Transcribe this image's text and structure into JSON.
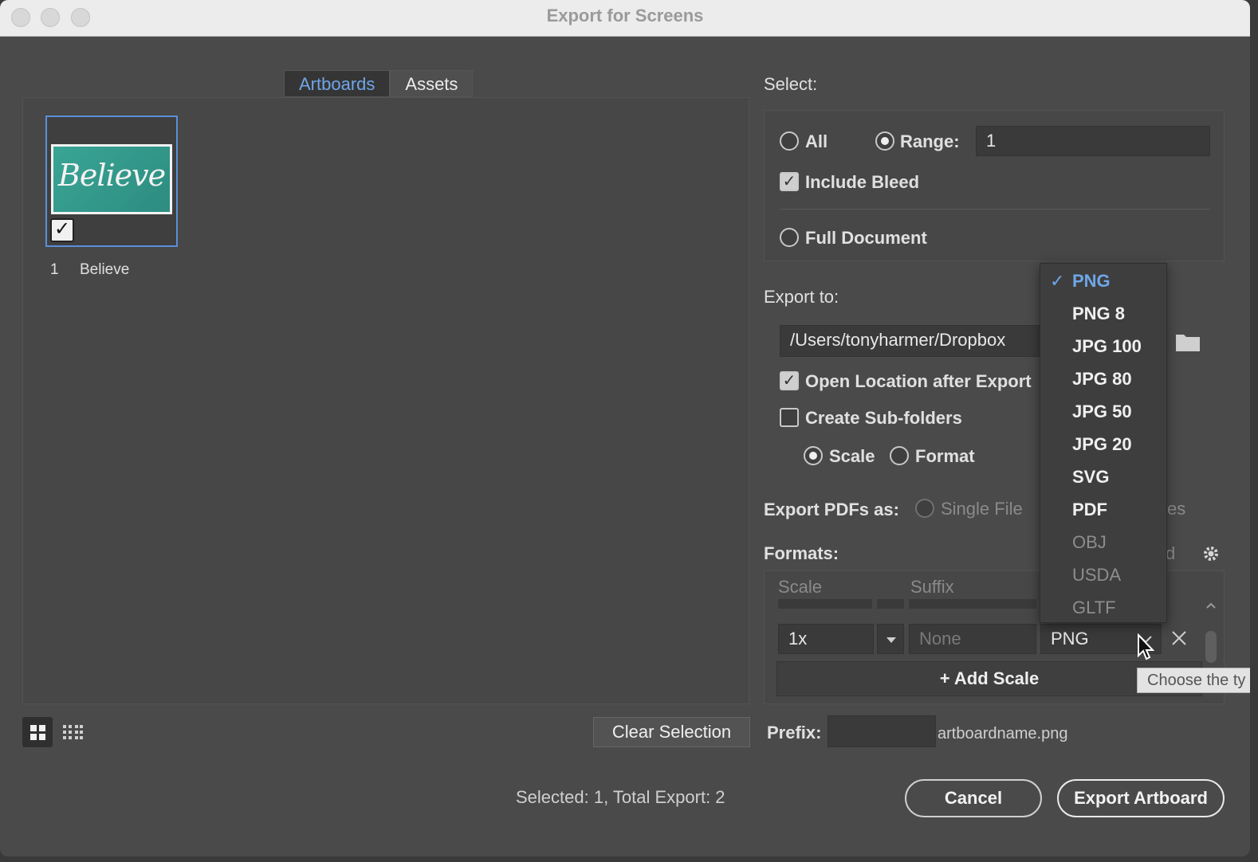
{
  "window": {
    "title": "Export for Screens"
  },
  "tabs": [
    {
      "label": "Artboards",
      "active": true
    },
    {
      "label": "Assets",
      "active": false
    }
  ],
  "artboard": {
    "index": "1",
    "name": "Believe",
    "thumb_text": "Believe",
    "checked": true
  },
  "left_footer": {
    "clear_selection": "Clear Selection",
    "status": "Selected: 1, Total Export: 2"
  },
  "select": {
    "heading": "Select:",
    "all_label": "All",
    "range_label": "Range:",
    "range_value": "1",
    "include_bleed": "Include Bleed",
    "full_document": "Full Document"
  },
  "export_to": {
    "heading": "Export to:",
    "path": "/Users/tonyharmer/Dropbox",
    "open_location": "Open Location after Export",
    "create_subfolders": "Create Sub-folders",
    "scale_label": "Scale",
    "format_label": "Format",
    "pdf_heading": "Export PDFs as:",
    "single_file": "Single File",
    "pdf_partial": "es"
  },
  "formats": {
    "heading": "Formats:",
    "heading_partial": "d",
    "col_scale": "Scale",
    "col_suffix": "Suffix",
    "row_scale": "1x",
    "row_suffix_placeholder": "None",
    "row_format": "PNG",
    "add_scale": "Add Scale"
  },
  "dropdown": {
    "items": [
      {
        "label": "PNG",
        "selected": true,
        "disabled": false
      },
      {
        "label": "PNG 8",
        "selected": false,
        "disabled": false
      },
      {
        "label": "JPG 100",
        "selected": false,
        "disabled": false
      },
      {
        "label": "JPG 80",
        "selected": false,
        "disabled": false
      },
      {
        "label": "JPG 50",
        "selected": false,
        "disabled": false
      },
      {
        "label": "JPG 20",
        "selected": false,
        "disabled": false
      },
      {
        "label": "SVG",
        "selected": false,
        "disabled": false
      },
      {
        "label": "PDF",
        "selected": false,
        "disabled": false
      },
      {
        "label": "OBJ",
        "selected": false,
        "disabled": true
      },
      {
        "label": "USDA",
        "selected": false,
        "disabled": true
      },
      {
        "label": "GLTF",
        "selected": false,
        "disabled": true
      }
    ]
  },
  "tooltip": {
    "text": "Choose the ty"
  },
  "prefix": {
    "label": "Prefix:",
    "value": "",
    "example": "artboardname.png"
  },
  "buttons": {
    "cancel": "Cancel",
    "export": "Export Artboard"
  },
  "colors": {
    "accent": "#6fa6e8",
    "window_bg": "#4a4a4a",
    "titlebar": "#ececec"
  }
}
